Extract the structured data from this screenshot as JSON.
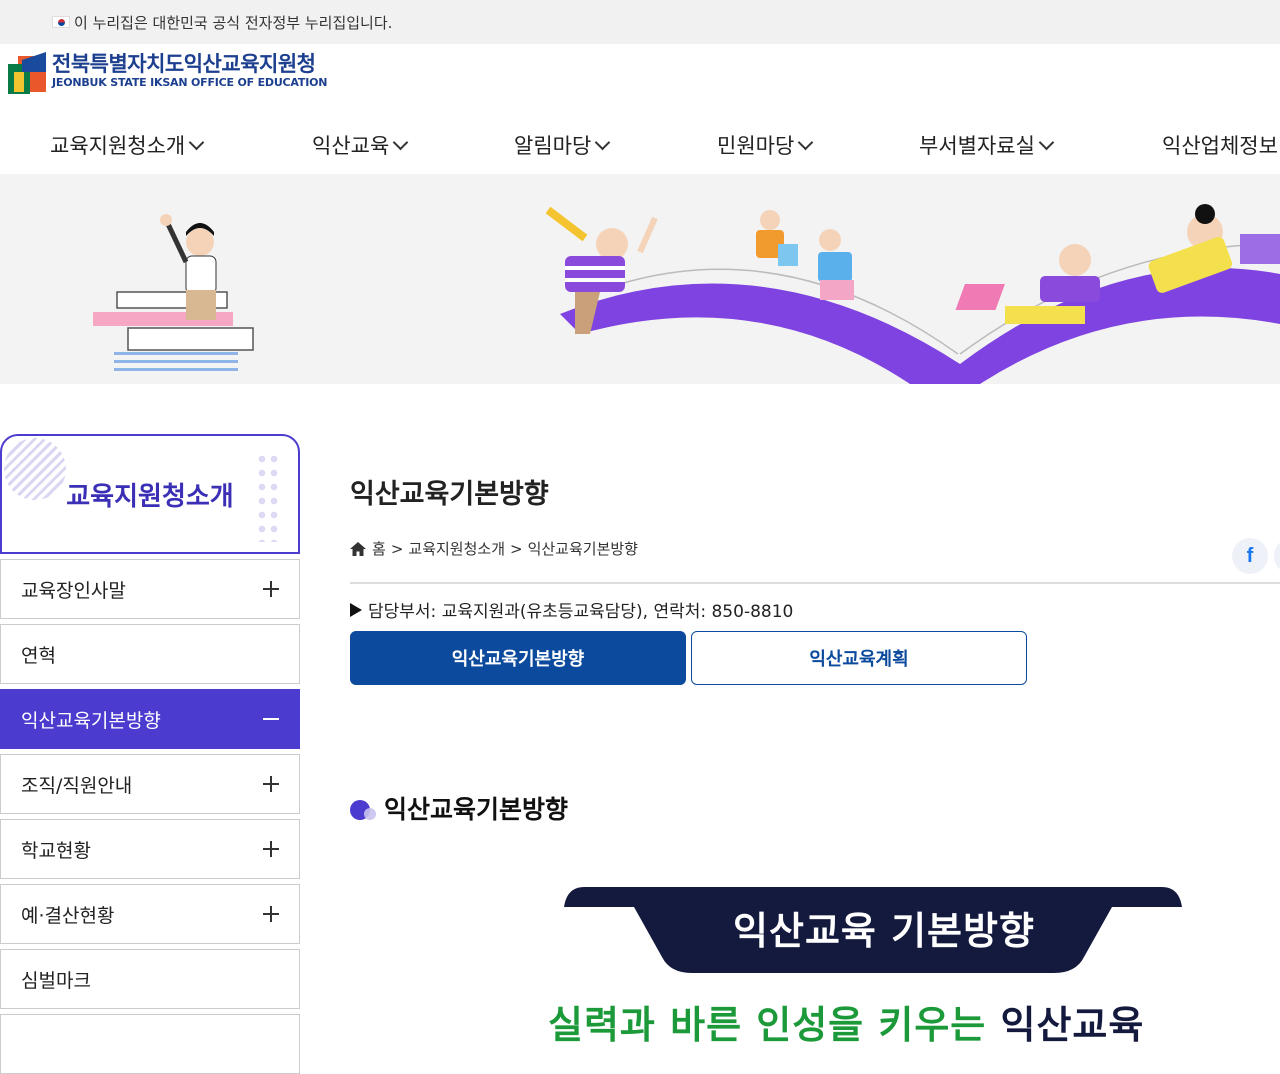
{
  "gov_bar": {
    "text": "이 누리집은 대한민국 공식 전자정부 누리집입니다."
  },
  "logo": {
    "title": "전북특별자치도익산교육지원청",
    "subtitle": "JEONBUK STATE IKSAN OFFICE OF EDUCATION"
  },
  "gnb": [
    {
      "label": "교육지원청소개"
    },
    {
      "label": "익산교육"
    },
    {
      "label": "알림마당"
    },
    {
      "label": "민원마당"
    },
    {
      "label": "부서별자료실"
    },
    {
      "label": "익산업체정보"
    }
  ],
  "lnb": {
    "title": "교육지원청소개",
    "items": [
      {
        "label": "교육장인사말"
      },
      {
        "label": "연혁"
      },
      {
        "label": "익산교육기본방향"
      },
      {
        "label": "조직/직원안내"
      },
      {
        "label": "학교현황"
      },
      {
        "label": "예·결산현황"
      },
      {
        "label": "심벌마크"
      }
    ]
  },
  "content": {
    "page_title": "익산교육기본방향",
    "breadcrumb": {
      "home": "홈",
      "sep": ">",
      "level1": "교육지원청소개",
      "level2": "익산교육기본방향"
    },
    "share_facebook": "f",
    "dept": "담당부서: 교육지원과(유초등교육담당), 연락처: 850-8810",
    "tabs": [
      {
        "label": "익산교육기본방향"
      },
      {
        "label": "익산교육계획"
      }
    ],
    "section_title": "익산교육기본방향",
    "poster": {
      "heading": "익산교육 기본방향",
      "subline_a": "실력과 바른 인성을 키우는 ",
      "subline_b": "익산교육"
    }
  },
  "colors": {
    "primary": "#4b3bcf",
    "tab_blue": "#0b4a9c",
    "logo_blue": "#1d3f8f"
  }
}
